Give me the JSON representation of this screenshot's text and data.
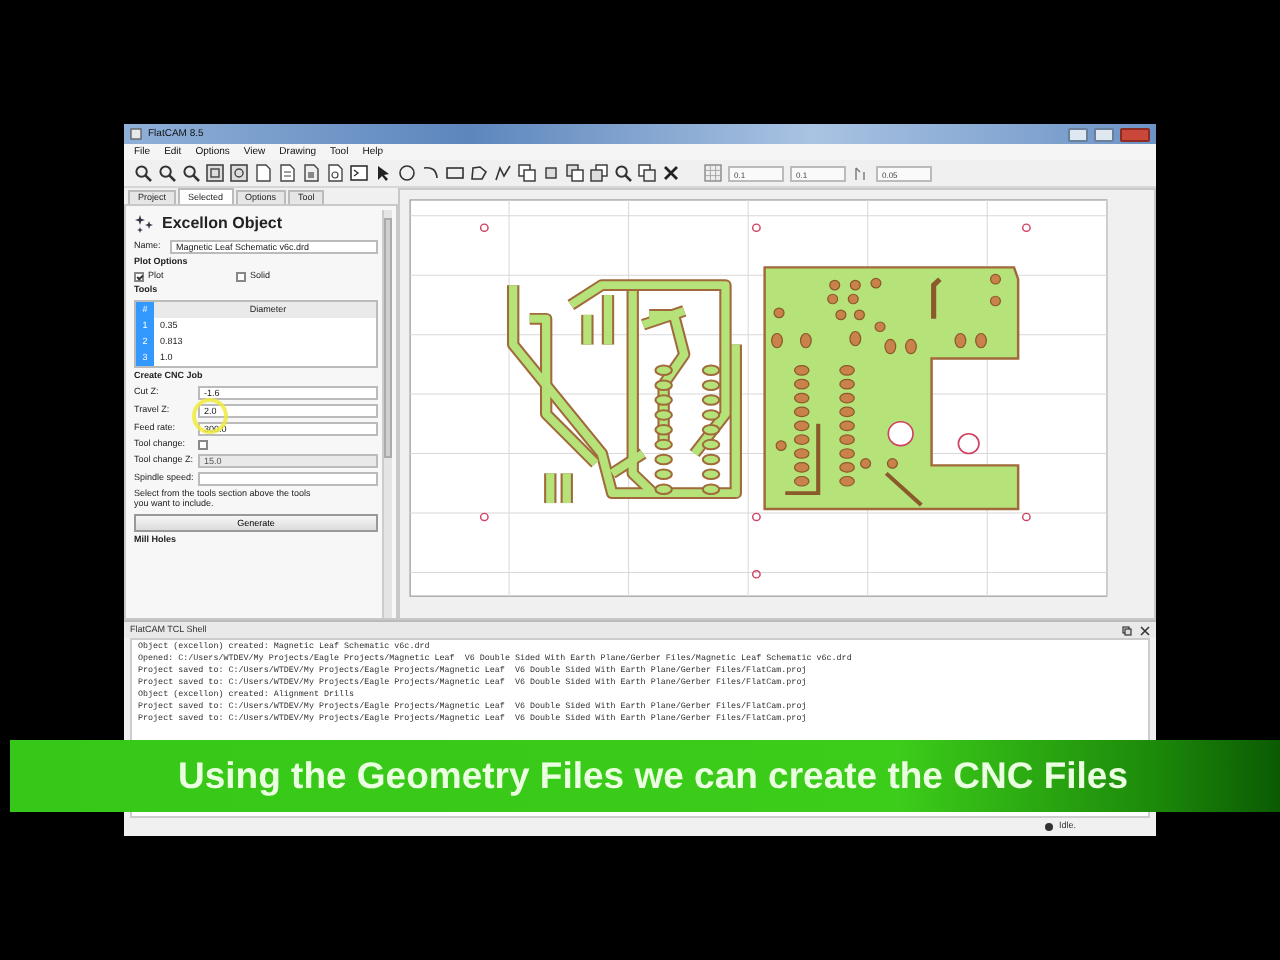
{
  "window": {
    "title": "FlatCAM 8.5"
  },
  "menu": [
    "File",
    "Edit",
    "Options",
    "View",
    "Drawing",
    "Tool",
    "Help"
  ],
  "toolbar_fields": [
    {
      "value": "0.1"
    },
    {
      "value": "0.1"
    },
    {
      "value": "0.05"
    }
  ],
  "tabs": [
    {
      "label": "Project",
      "selected": false
    },
    {
      "label": "Selected",
      "selected": true
    },
    {
      "label": "Options",
      "selected": false
    },
    {
      "label": "Tool",
      "selected": false
    }
  ],
  "panel": {
    "title": "Excellon Object",
    "name_label": "Name:",
    "name_value": "Magnetic Leaf Schematic v6c.drd",
    "plot_options_heading": "Plot Options",
    "plot_checks": [
      {
        "label": "Plot",
        "checked": true
      },
      {
        "label": "Solid",
        "checked": false
      }
    ],
    "tools_heading": "Tools",
    "tools_table": {
      "columns": [
        "#",
        "Diameter"
      ],
      "rows": [
        [
          "1",
          "0.35"
        ],
        [
          "2",
          "0.813"
        ],
        [
          "3",
          "1.0"
        ]
      ]
    },
    "cnc_heading": "Create CNC Job",
    "cnc_fields": [
      {
        "kind": "field",
        "label": "Cut Z:",
        "value": "-1.6",
        "disabled": false
      },
      {
        "kind": "field",
        "label": "Travel Z:",
        "value": "2.0",
        "disabled": false
      },
      {
        "kind": "field",
        "label": "Feed rate:",
        "value": "300.0",
        "disabled": false
      },
      {
        "kind": "check",
        "label": "Tool change:",
        "checked": false
      },
      {
        "kind": "field",
        "label": "Tool change Z:",
        "value": "15.0",
        "disabled": true
      },
      {
        "kind": "field",
        "label": "Spindle speed:",
        "disabled": false
      }
    ],
    "hint": "Select from the tools section above the tools you want to include.",
    "generate_button": "Generate",
    "mill_heading": "Mill Holes"
  },
  "shell": {
    "title": "FlatCAM TCL Shell",
    "lines": [
      "Object (excellon) created: Magnetic Leaf Schematic v6c.drd",
      "Opened: C:/Users/WTDEV/My Projects/Eagle Projects/Magnetic Leaf  V6 Double Sided With Earth Plane/Gerber Files/Magnetic Leaf Schematic v6c.drd",
      "Project saved to: C:/Users/WTDEV/My Projects/Eagle Projects/Magnetic Leaf  V6 Double Sided With Earth Plane/Gerber Files/FlatCam.proj",
      "Project saved to: C:/Users/WTDEV/My Projects/Eagle Projects/Magnetic Leaf  V6 Double Sided With Earth Plane/Gerber Files/FlatCam.proj",
      "Object (excellon) created: Alignment Drills",
      "Project saved to: C:/Users/WTDEV/My Projects/Eagle Projects/Magnetic Leaf  V6 Double Sided With Earth Plane/Gerber Files/FlatCam.proj",
      "Project saved to: C:/Users/WTDEV/My Projects/Eagle Projects/Magnetic Leaf  V6 Double Sided With Earth Plane/Gerber Files/FlatCam.proj"
    ]
  },
  "status_bar": {
    "text": "Idle."
  },
  "caption": "Using the Geometry Files we can create the CNC Files"
}
